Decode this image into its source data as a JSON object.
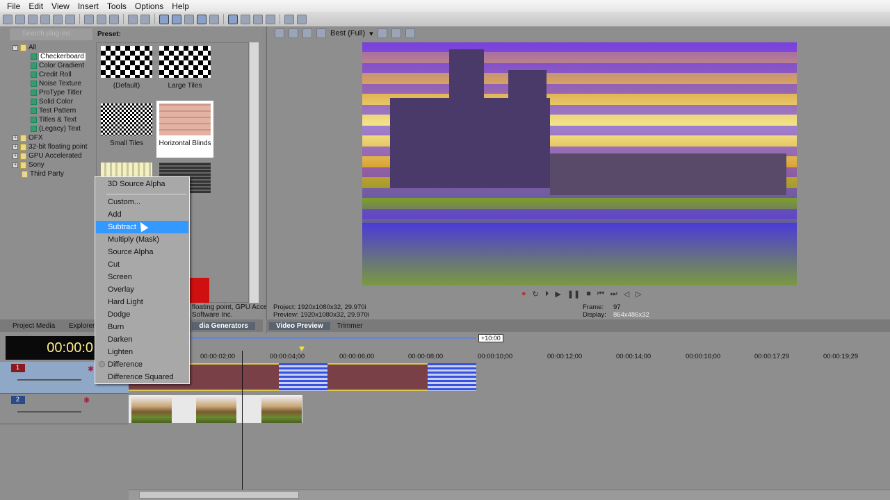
{
  "menu": [
    "File",
    "Edit",
    "View",
    "Insert",
    "Tools",
    "Options",
    "Help"
  ],
  "plugins": {
    "search_placeholder": "Search plug-ins",
    "preset_label": "Preset:",
    "tree": [
      {
        "label": "All",
        "type": "folder",
        "expanded": true
      },
      {
        "label": "Checkerboard",
        "type": "generator",
        "selected": true
      },
      {
        "label": "Color Gradient",
        "type": "generator"
      },
      {
        "label": "Credit Roll",
        "type": "generator"
      },
      {
        "label": "Noise Texture",
        "type": "generator"
      },
      {
        "label": "ProType Titler",
        "type": "generator"
      },
      {
        "label": "Solid Color",
        "type": "generator"
      },
      {
        "label": "Test Pattern",
        "type": "generator"
      },
      {
        "label": "Titles & Text",
        "type": "generator"
      },
      {
        "label": "(Legacy) Text",
        "type": "generator"
      },
      {
        "label": "OFX",
        "type": "folder"
      },
      {
        "label": "32-bit floating point",
        "type": "folder"
      },
      {
        "label": "GPU Accelerated",
        "type": "folder"
      },
      {
        "label": "Sony",
        "type": "folder"
      },
      {
        "label": "Third Party",
        "type": "folder"
      }
    ],
    "presets": [
      {
        "label": "(Default)"
      },
      {
        "label": "Large Tiles"
      },
      {
        "label": "Small Tiles"
      },
      {
        "label": "Horizontal Blinds"
      }
    ],
    "info_line1": "floating point, GPU Acce",
    "info_line2": "Software Inc.",
    "tabs": [
      "Project Media",
      "Explorer",
      "dia Generators"
    ]
  },
  "preview": {
    "quality": "Best (Full)",
    "project": "Project:   1920x1080x32, 29.970i",
    "preview": "Preview:  1920x1080x32, 29.970i",
    "frame_label": "Frame:",
    "frame": "97",
    "display_label": "Display:",
    "display": "864x486x32",
    "tabs": [
      "Video Preview",
      "Trimmer"
    ]
  },
  "timeline": {
    "timecode": "00:00:0",
    "offset": "+10:00",
    "ruler": [
      "00:00:02;00",
      "00:00:04;00",
      "00:00:06;00",
      "00:00:08;00",
      "00:00:10;00",
      "00:00:12;00",
      "00:00:14;00",
      "00:00:16;00",
      "00:00:17;29",
      "00:00:19;29"
    ],
    "tracks": [
      "1",
      "2"
    ]
  },
  "context_menu": {
    "items": [
      "3D Source Alpha",
      "Custom...",
      "Add",
      "Subtract",
      "Multiply (Mask)",
      "Source Alpha",
      "Cut",
      "Screen",
      "Overlay",
      "Hard Light",
      "Dodge",
      "Burn",
      "Darken",
      "Lighten",
      "Difference",
      "Difference Squared"
    ],
    "highlighted": "Subtract",
    "checked": "Difference"
  },
  "colors": {
    "highlight": "#3399ff",
    "timecode": "#ffef90"
  }
}
